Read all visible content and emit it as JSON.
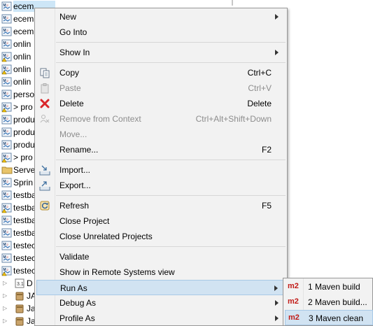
{
  "explorer": {
    "rows": [
      {
        "label": "ecem",
        "icon": "maven-project-icon",
        "kind": "project",
        "selected": true
      },
      {
        "label": "ecem",
        "icon": "maven-project-icon",
        "kind": "project"
      },
      {
        "label": "ecem",
        "icon": "maven-project-icon",
        "kind": "project"
      },
      {
        "label": "onlin",
        "icon": "maven-project-icon",
        "kind": "project"
      },
      {
        "label": "onlin",
        "icon": "maven-project-warning-icon",
        "kind": "project"
      },
      {
        "label": "onlin",
        "icon": "maven-project-warning-icon",
        "kind": "project"
      },
      {
        "label": "onlin",
        "icon": "maven-project-icon",
        "kind": "project"
      },
      {
        "label": "perso",
        "icon": "maven-project-icon",
        "kind": "project"
      },
      {
        "label": "> pro",
        "icon": "maven-project-warning-icon",
        "kind": "project"
      },
      {
        "label": "produ",
        "icon": "maven-project-icon",
        "kind": "project"
      },
      {
        "label": "produ",
        "icon": "maven-project-icon",
        "kind": "project"
      },
      {
        "label": "produ",
        "icon": "maven-project-icon",
        "kind": "project"
      },
      {
        "label": "> pro",
        "icon": "maven-project-warning-icon",
        "kind": "project"
      },
      {
        "label": "Serve",
        "icon": "folder-icon",
        "kind": "project"
      },
      {
        "label": "Sprin",
        "icon": "maven-project-icon",
        "kind": "project"
      },
      {
        "label": "testba",
        "icon": "maven-project-icon",
        "kind": "project"
      },
      {
        "label": "testba",
        "icon": "maven-project-warning-icon",
        "kind": "project"
      },
      {
        "label": "testba",
        "icon": "maven-project-icon",
        "kind": "project"
      },
      {
        "label": "testba",
        "icon": "maven-project-icon",
        "kind": "project"
      },
      {
        "label": "testec",
        "icon": "maven-project-icon",
        "kind": "project"
      },
      {
        "label": "testec",
        "icon": "maven-project-icon",
        "kind": "project"
      },
      {
        "label": "testec",
        "icon": "maven-project-warning-icon",
        "kind": "project"
      },
      {
        "label": "D",
        "icon": "library-icon",
        "kind": "lib"
      },
      {
        "label": "JA",
        "icon": "jar-icon",
        "kind": "lib"
      },
      {
        "label": "Ja",
        "icon": "jar-icon",
        "kind": "lib"
      },
      {
        "label": "Ja",
        "icon": "jar-icon",
        "kind": "lib"
      }
    ]
  },
  "context_menu": {
    "items": [
      {
        "type": "item",
        "label": "New",
        "submenu": true,
        "name": "menu-item-new"
      },
      {
        "type": "item",
        "label": "Go Into",
        "name": "menu-item-go-into"
      },
      {
        "type": "sep"
      },
      {
        "type": "item",
        "label": "Show In",
        "submenu": true,
        "name": "menu-item-show-in"
      },
      {
        "type": "sep"
      },
      {
        "type": "item",
        "label": "Copy",
        "accel": "Ctrl+C",
        "icon": "copy-icon",
        "name": "menu-item-copy"
      },
      {
        "type": "item",
        "label": "Paste",
        "accel": "Ctrl+V",
        "icon": "paste-icon",
        "disabled": true,
        "name": "menu-item-paste"
      },
      {
        "type": "item",
        "label": "Delete",
        "accel": "Delete",
        "icon": "delete-icon",
        "name": "menu-item-delete"
      },
      {
        "type": "item",
        "label": "Remove from Context",
        "accel": "Ctrl+Alt+Shift+Down",
        "icon": "remove-context-icon",
        "disabled": true,
        "name": "menu-item-remove-from-context"
      },
      {
        "type": "item",
        "label": "Move...",
        "disabled": true,
        "name": "menu-item-move"
      },
      {
        "type": "item",
        "label": "Rename...",
        "accel": "F2",
        "name": "menu-item-rename"
      },
      {
        "type": "sep"
      },
      {
        "type": "item",
        "label": "Import...",
        "icon": "import-icon",
        "name": "menu-item-import"
      },
      {
        "type": "item",
        "label": "Export...",
        "icon": "export-icon",
        "name": "menu-item-export"
      },
      {
        "type": "sep"
      },
      {
        "type": "item",
        "label": "Refresh",
        "accel": "F5",
        "icon": "refresh-icon",
        "name": "menu-item-refresh"
      },
      {
        "type": "item",
        "label": "Close Project",
        "name": "menu-item-close-project"
      },
      {
        "type": "item",
        "label": "Close Unrelated Projects",
        "name": "menu-item-close-unrelated-projects"
      },
      {
        "type": "sep"
      },
      {
        "type": "item",
        "label": "Validate",
        "name": "menu-item-validate"
      },
      {
        "type": "item",
        "label": "Show in Remote Systems view",
        "name": "menu-item-show-in-remote-systems"
      },
      {
        "type": "item",
        "label": "Run As",
        "submenu": true,
        "hover": true,
        "name": "menu-item-run-as"
      },
      {
        "type": "item",
        "label": "Debug As",
        "submenu": true,
        "name": "menu-item-debug-as"
      },
      {
        "type": "item",
        "label": "Profile As",
        "submenu": true,
        "name": "menu-item-profile-as"
      }
    ]
  },
  "run_as_submenu": {
    "items": [
      {
        "label": "1 Maven build",
        "icon_text": "m2",
        "name": "submenu-item-maven-build"
      },
      {
        "label": "2 Maven build...",
        "icon_text": "m2",
        "name": "submenu-item-maven-build-config"
      },
      {
        "label": "3 Maven clean",
        "icon_text": "m2",
        "hover": true,
        "name": "submenu-item-maven-clean"
      }
    ]
  },
  "colors": {
    "menu_bg": "#f2f2f2",
    "hover_bg": "#d1e3f2",
    "disabled_text": "#8d8d8d",
    "m2_red": "#c11b17",
    "selection_bg": "#cde6f7"
  }
}
